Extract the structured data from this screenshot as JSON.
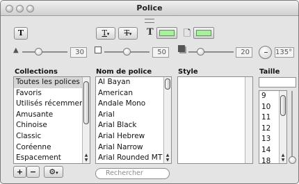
{
  "window": {
    "title": "Police"
  },
  "toolbar": {
    "text_style_glyph": "T",
    "underline_glyph": "T",
    "strike_glyph": "T",
    "text_color_glyph": "T",
    "doc_color_glyph": "D",
    "text_color": "#a8f0a0",
    "doc_color": "#a8f0a0"
  },
  "shadow": {
    "opacity": "30",
    "blur": "50",
    "offset": "20",
    "angle": "135°"
  },
  "collections": {
    "header": "Collections",
    "items": [
      "Toutes les polices",
      "Favoris",
      "Utilisés récemment",
      "Amusante",
      "Chinoise",
      "Classic",
      "Coréenne",
      "Espacement"
    ],
    "selected": "Toutes les polices"
  },
  "fonts": {
    "header": "Nom de police",
    "items": [
      "Al Bayan",
      "American",
      "Andale Mono",
      "Arial",
      "Arial Black",
      "Arial Hebrew",
      "Arial Narrow",
      "Arial Rounded MT"
    ]
  },
  "style": {
    "header": "Style"
  },
  "size": {
    "header": "Taille",
    "value": "",
    "items": [
      "9",
      "10",
      "11",
      "12",
      "13",
      "14",
      "18"
    ]
  },
  "bottom": {
    "add": "+",
    "remove": "−",
    "search_placeholder": "Rechercher"
  }
}
